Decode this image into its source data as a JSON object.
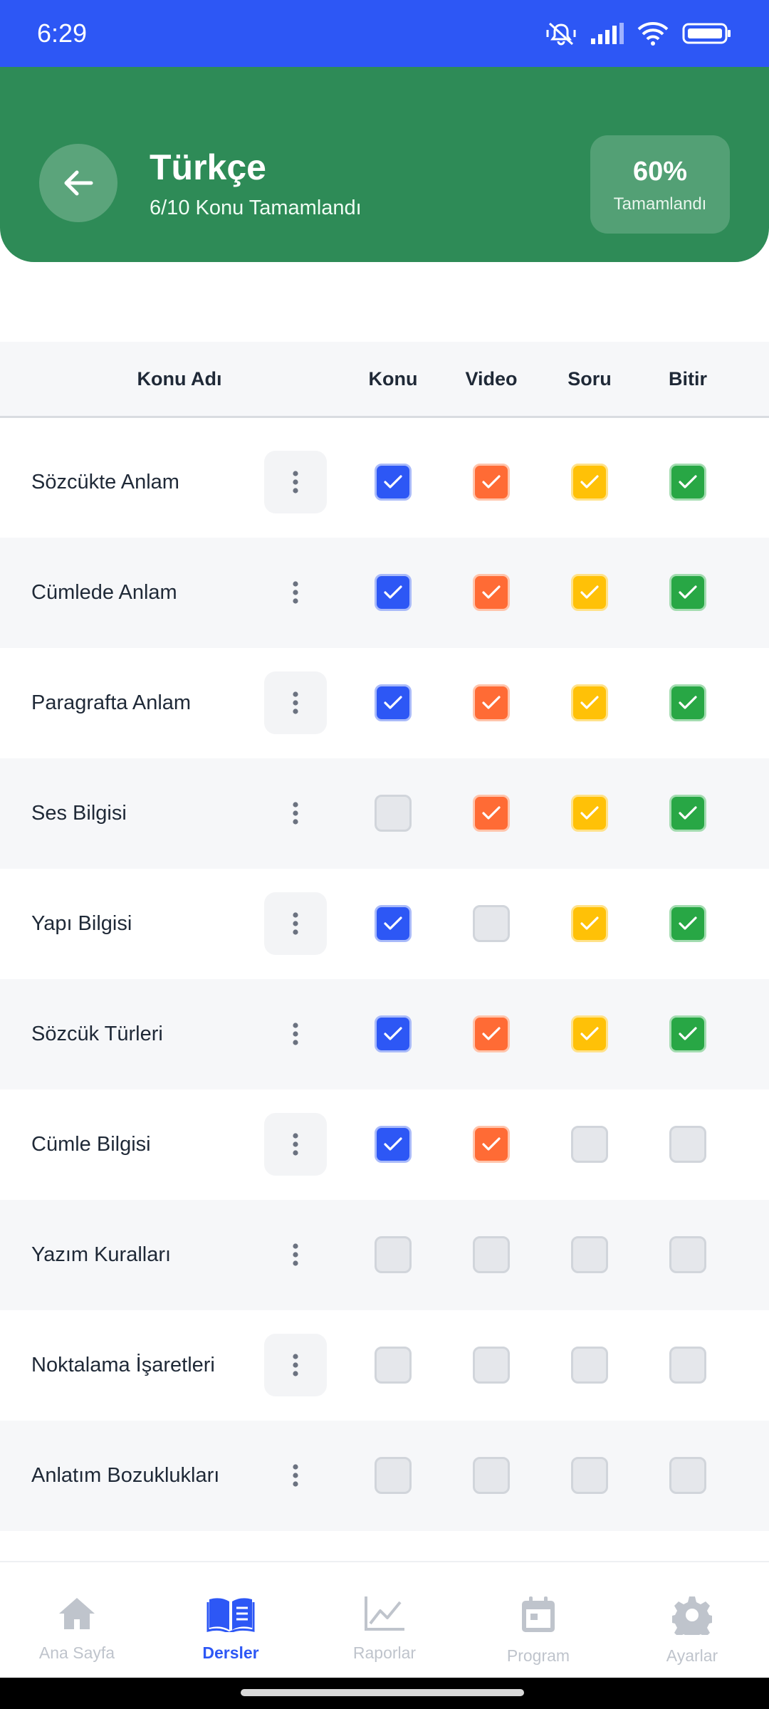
{
  "status_bar": {
    "time": "6:29",
    "icons": [
      "mute-vibrate-icon",
      "signal-icon",
      "wifi-icon",
      "battery-icon"
    ]
  },
  "header": {
    "title": "Türkçe",
    "subtitle": "6/10 Konu Tamamlandı",
    "percent": "60%",
    "percent_label": "Tamamlandı",
    "bg_color": "#2e8b57"
  },
  "table": {
    "columns": {
      "name": "Konu Adı",
      "konu": "Konu",
      "video": "Video",
      "soru": "Soru",
      "bitir": "Bitir"
    },
    "rows": [
      {
        "name": "Sözcükte Anlam",
        "konu": true,
        "video": true,
        "soru": true,
        "bitir": true
      },
      {
        "name": "Cümlede Anlam",
        "konu": true,
        "video": true,
        "soru": true,
        "bitir": true
      },
      {
        "name": "Paragrafta Anlam",
        "konu": true,
        "video": true,
        "soru": true,
        "bitir": true
      },
      {
        "name": "Ses Bilgisi",
        "konu": false,
        "video": true,
        "soru": true,
        "bitir": true
      },
      {
        "name": "Yapı Bilgisi",
        "konu": true,
        "video": false,
        "soru": true,
        "bitir": true
      },
      {
        "name": "Sözcük Türleri",
        "konu": true,
        "video": true,
        "soru": true,
        "bitir": true
      },
      {
        "name": "Cümle Bilgisi",
        "konu": true,
        "video": true,
        "soru": false,
        "bitir": false
      },
      {
        "name": "Yazım Kuralları",
        "konu": false,
        "video": false,
        "soru": false,
        "bitir": false
      },
      {
        "name": "Noktalama İşaretleri",
        "konu": false,
        "video": false,
        "soru": false,
        "bitir": false
      },
      {
        "name": "Anlatım Bozuklukları",
        "konu": false,
        "video": false,
        "soru": false,
        "bitir": false
      }
    ]
  },
  "bottom_nav": {
    "items": [
      {
        "label": "Ana Sayfa",
        "icon": "home-icon",
        "active": false
      },
      {
        "label": "Dersler",
        "icon": "book-icon",
        "active": true
      },
      {
        "label": "Raporlar",
        "icon": "chart-icon",
        "active": false
      },
      {
        "label": "Program",
        "icon": "calendar-icon",
        "active": false
      },
      {
        "label": "Ayarlar",
        "icon": "gear-icon",
        "active": false
      }
    ]
  },
  "colors": {
    "status_bar": "#2d57f5",
    "konu": "#2d57f5",
    "video": "#ff6b35",
    "soru": "#ffc107",
    "bitir": "#28a745",
    "unchecked": "#e5e7eb",
    "nav_active": "#2d57f5",
    "nav_inactive": "#bfc4cc"
  }
}
